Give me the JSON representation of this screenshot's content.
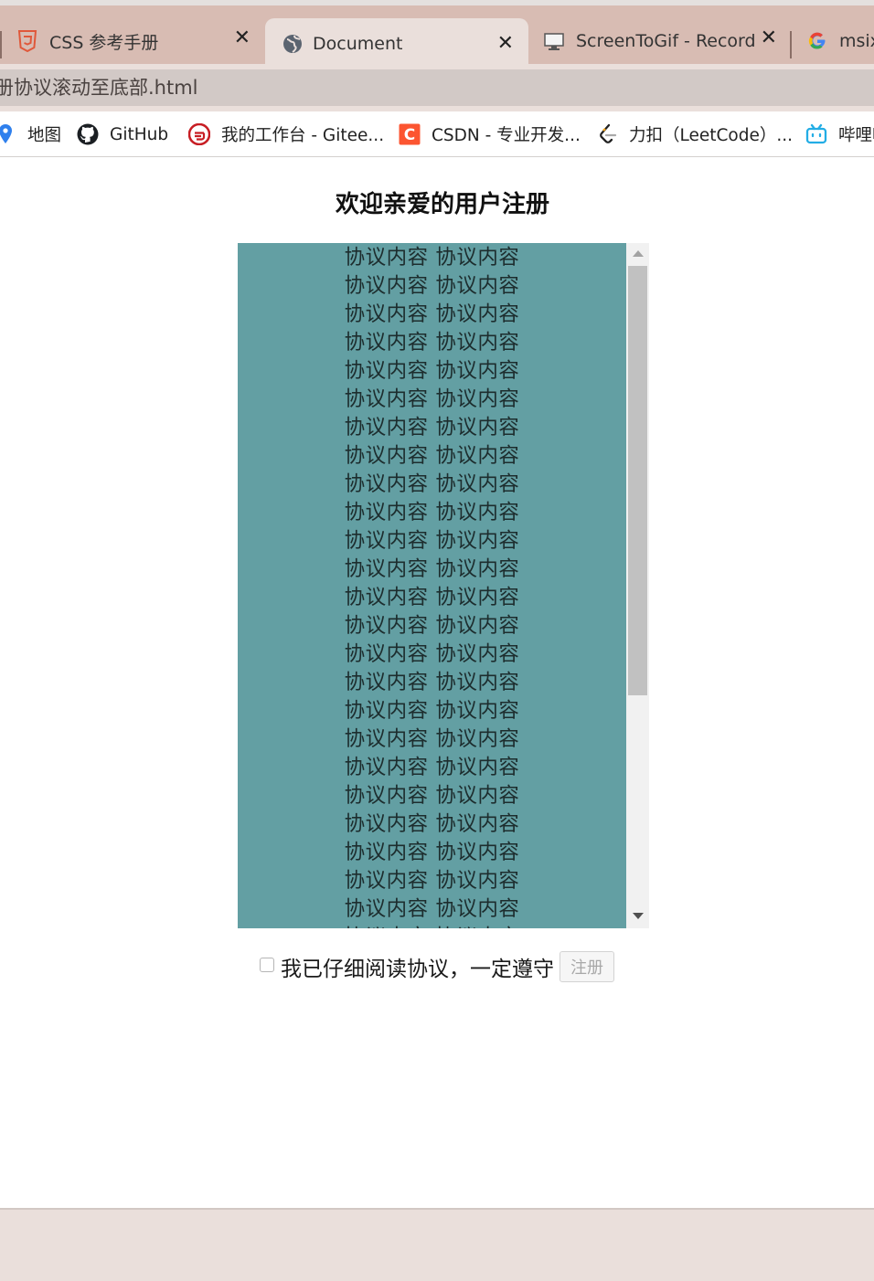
{
  "browser": {
    "tabs": [
      {
        "label": "CSS 参考手册",
        "icon": "html5-shield-icon",
        "active": false
      },
      {
        "label": "Document",
        "icon": "globe-icon",
        "active": true
      },
      {
        "label": "ScreenToGif - Record y",
        "icon": "monitor-icon",
        "active": false
      },
      {
        "label": "msix",
        "icon": "google-g-icon",
        "active": false
      }
    ],
    "close_glyph": "✕",
    "address": "册协议滚动至底部.html",
    "bookmarks": [
      {
        "label": "地图",
        "icon": "map-pin-icon"
      },
      {
        "label": "GitHub",
        "icon": "github-icon"
      },
      {
        "label": "我的工作台 - Gitee...",
        "icon": "gitee-icon"
      },
      {
        "label": "CSDN - 专业开发...",
        "icon": "csdn-icon"
      },
      {
        "label": "力扣（LeetCode）...",
        "icon": "leetcode-icon"
      },
      {
        "label": "哔哩哔",
        "icon": "bilibili-icon"
      }
    ]
  },
  "page": {
    "title": "欢迎亲爱的用户注册",
    "agreement_line": "协议内容 协议内容",
    "agreement_line_count": 25,
    "agree_label": "我已仔细阅读协议，一定遵守",
    "register_label": "注册"
  },
  "colors": {
    "agreement_bg": "#639fa3",
    "tabstrip_bg": "#d8bcb3",
    "active_tab_bg": "#eadfdb"
  }
}
